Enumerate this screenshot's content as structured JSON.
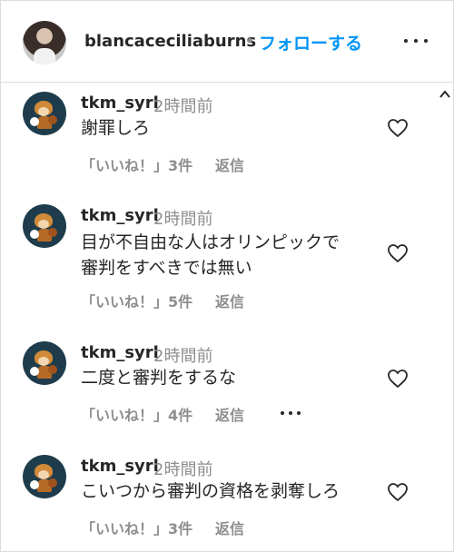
{
  "post_header": {
    "username": "blancaceciliaburns",
    "separator": "•",
    "follow_label": "フォローする"
  },
  "comments": [
    {
      "username": "tkm_syrl",
      "time": "2時間前",
      "lines": [
        "謝罪しろ"
      ],
      "likes_label": "「いいね！」3件",
      "reply_label": "返信"
    },
    {
      "username": "tkm_syrl",
      "time": "2時間前",
      "lines": [
        "目が不自由な人はオリンピックで",
        "審判をすべきでは無い"
      ],
      "likes_label": "「いいね！」5件",
      "reply_label": "返信"
    },
    {
      "username": "tkm_syrl",
      "time": "2時間前",
      "lines": [
        "二度と審判をするな"
      ],
      "likes_label": "「いいね！」4件",
      "reply_label": "返信"
    },
    {
      "username": "tkm_syrl",
      "time": "2時間前",
      "lines": [
        "こいつから審判の資格を剥奪しろ"
      ],
      "likes_label": "「いいね！」3件",
      "reply_label": "返信"
    }
  ],
  "icons": {
    "more": "more-options-icon",
    "heart": "heart-outline-icon",
    "scroll": "chevron-up-icon"
  },
  "colors": {
    "follow_blue": "#0095f6",
    "secondary_text": "#8e8e8e",
    "primary_text": "#262626"
  }
}
